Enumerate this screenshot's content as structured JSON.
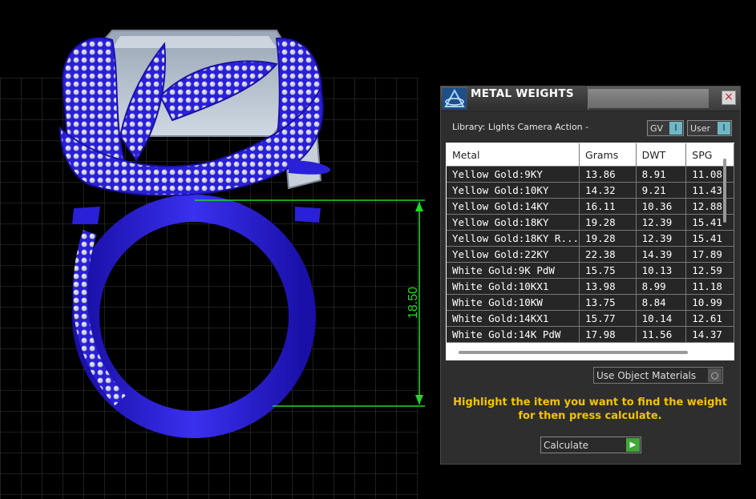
{
  "viewport": {
    "dimension_text": "18.50",
    "colors": {
      "ring": "#2a20d8",
      "grid": "#3a3a3a",
      "dimension": "#23d823",
      "stone": "#b8c4d2"
    }
  },
  "panel": {
    "title": "METAL WEIGHTS",
    "close_icon": "×",
    "library_label": "Library: Lights Camera Action -",
    "toggles": [
      {
        "label": "GV",
        "state": "I"
      },
      {
        "label": "User",
        "state": "I"
      }
    ],
    "table": {
      "columns": [
        "Metal",
        "Grams",
        "DWT",
        "SPG"
      ],
      "rows": [
        [
          "Yellow Gold:9KY",
          "13.86",
          "8.91",
          "11.08"
        ],
        [
          "Yellow Gold:10KY",
          "14.32",
          "9.21",
          "11.43"
        ],
        [
          "Yellow Gold:14KY",
          "16.11",
          "10.36",
          "12.88"
        ],
        [
          "Yellow Gold:18KY",
          "19.28",
          "12.39",
          "15.41"
        ],
        [
          "Yellow Gold:18KY R...",
          "19.28",
          "12.39",
          "15.41"
        ],
        [
          "Yellow Gold:22KY",
          "22.38",
          "14.39",
          "17.89"
        ],
        [
          "White Gold:9K PdW",
          "15.75",
          "10.13",
          "12.59"
        ],
        [
          "White Gold:10KX1",
          "13.98",
          "8.99",
          "11.18"
        ],
        [
          "White Gold:10KW",
          "13.75",
          "8.84",
          "10.99"
        ],
        [
          "White Gold:14KX1",
          "15.77",
          "10.14",
          "12.61"
        ],
        [
          "White Gold:14K PdW",
          "17.98",
          "11.56",
          "14.37"
        ]
      ]
    },
    "dropdown_value": "Use Object Materials",
    "hint_text": "Highlight the item you want to find the weight for then press calculate.",
    "calculate_label": "Calculate",
    "colors": {
      "hint": "#f5c400",
      "calc_arrow": "#3fa836",
      "toggle": "#6fb7c7"
    }
  }
}
